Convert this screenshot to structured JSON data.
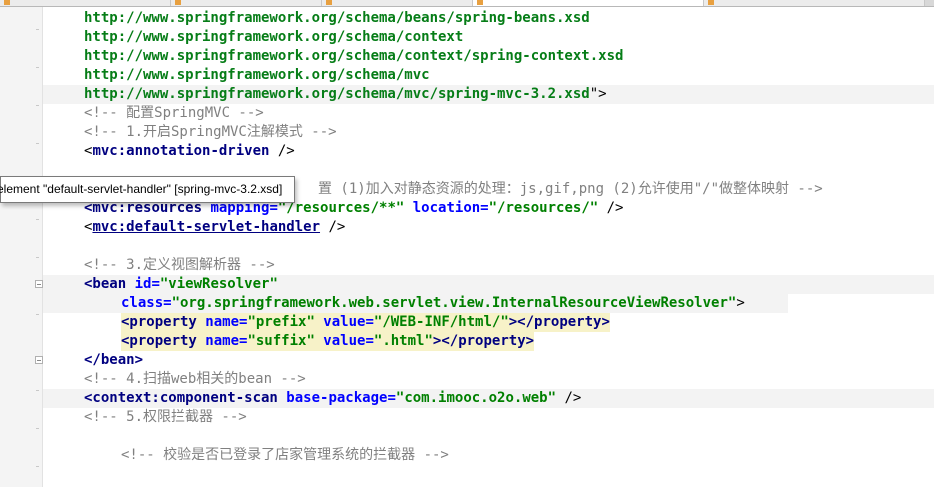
{
  "lines": {
    "l1": "http://www.springframework.org/schema/beans/spring-beans.xsd",
    "l2": "http://www.springframework.org/schema/context",
    "l3": "http://www.springframework.org/schema/context/spring-context.xsd",
    "l4": "http://www.springframework.org/schema/mvc",
    "l5": "http://www.springframework.org/schema/mvc/spring-mvc-3.2.xsd",
    "l5_end": "\">",
    "c1": "<!-- 配置SpringMVC -->",
    "c2": "<!-- 1.开启SpringMVC注解模式 -->",
    "ann_open": "<",
    "ann_tag": "mvc:annotation-driven",
    "ann_close": " />",
    "c3": "置 (1)加入对静态资源的处理：js,gif,png (2)允许使用\"/\"做整体映射 -->",
    "res_open": "<mvc:",
    "res_partial": "resources",
    "res_attr1": " mapping=",
    "res_val1": "\"/resources/**\"",
    "res_attr2": " location=",
    "res_val2": "\"/resources/\"",
    "res_close": " />",
    "dsh_open": "<",
    "dsh_tag": "mvc:default-servlet-handler",
    "dsh_close": " />",
    "c4": "<!-- 3.定义视图解析器 -->",
    "bean_open": "<bean",
    "bean_attr": " id=",
    "bean_val": "\"viewResolver\"",
    "class_attr": "class=",
    "class_val": "\"org.springframework.web.servlet.view.InternalResourceViewResolver\"",
    "class_end": ">",
    "p1_open": "<property",
    "p1_name_attr": " name=",
    "p1_name_val": "\"prefix\"",
    "p1_value_attr": " value=",
    "p1_value_val": "\"/WEB-INF/html/\"",
    "p1_close": "></property>",
    "p2_open": "<property",
    "p2_name_attr": " name=",
    "p2_name_val": "\"suffix\"",
    "p2_value_attr": " value=",
    "p2_value_val": "\".html\"",
    "p2_close": "></property>",
    "bean_end": "</bean>",
    "c5": "<!-- 4.扫描web相关的bean -->",
    "cs_open": "<context:component-scan",
    "cs_attr": " base-package=",
    "cs_val": "\"com.imooc.o2o.web\"",
    "cs_close": " />",
    "c6": "<!-- 5.权限拦截器 -->",
    "c7": "<!-- 校验是否已登录了店家管理系统的拦截器 -->"
  },
  "tooltip": {
    "text": "element \"default-servlet-handler\" [spring-mvc-3.2.xsd]"
  },
  "colors": {
    "url": "#067d17",
    "comment": "#808080",
    "tag": "#000080",
    "attribute": "#0000ff",
    "string": "#008000"
  }
}
